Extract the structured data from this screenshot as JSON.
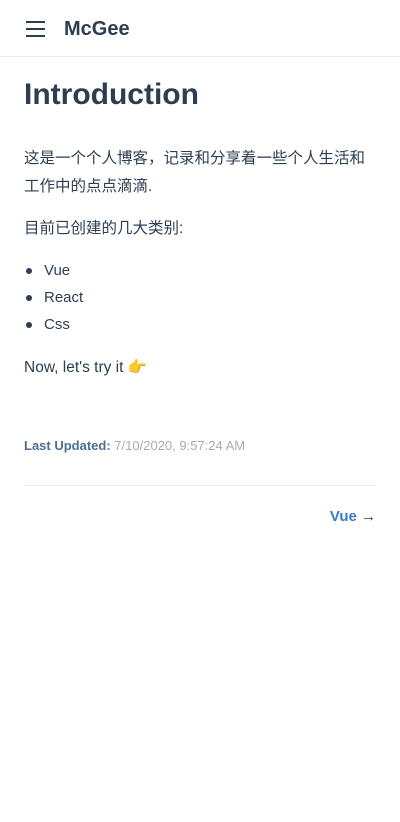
{
  "navbar": {
    "menu_icon": "hamburger-icon",
    "site_name": "McGee"
  },
  "page": {
    "title": "Introduction",
    "paragraph_1": "这是一个个人博客，记录和分享着一些个人生活和工作中的点点滴滴.",
    "paragraph_2": "目前已创建的几大类别:",
    "categories": [
      "Vue",
      "React",
      "Css"
    ],
    "paragraph_3": "Now, let's try it 👉"
  },
  "footer": {
    "last_updated_label": "Last Updated:",
    "last_updated_value": "7/10/2020, 9:57:24 AM",
    "next_label": "Vue",
    "next_arrow": "→"
  },
  "colors": {
    "text": "#2c3e50",
    "accent": "#3a7bc8",
    "muted": "#aaaaaa",
    "border": "#eaecef"
  }
}
